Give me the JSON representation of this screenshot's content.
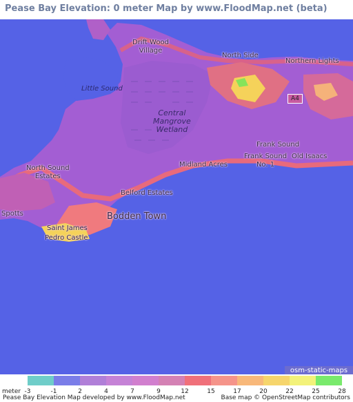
{
  "title": "Pease Bay Elevation: 0 meter Map by www.FloodMap.net (beta)",
  "map": {
    "colors": {
      "sea": "#5562e6",
      "land_low": "#a35ed3",
      "land_mid": "#c560b8",
      "land_high": "#f07a7e",
      "land_peak": "#f5d25a",
      "land_top": "#86e45a"
    },
    "places": [
      {
        "id": "drift-wood-village",
        "text": "Drift Wood\nVillage"
      },
      {
        "id": "north-side",
        "text": "North Side"
      },
      {
        "id": "northern-lights",
        "text": "Northern Lights"
      },
      {
        "id": "little-sound",
        "text": "Little Sound"
      },
      {
        "id": "central-mangrove-wetland",
        "text": "Central\nMangrove\nWetland"
      },
      {
        "id": "frank-sound",
        "text": "Frank Sound"
      },
      {
        "id": "frank-sound-no-1",
        "text": "Frank Sound\nNo. 1"
      },
      {
        "id": "old-isaacs",
        "text": "Old Isaacs"
      },
      {
        "id": "north-sound-estates",
        "text": "North Sound\nEstates"
      },
      {
        "id": "midland-acres",
        "text": "Midland Acres"
      },
      {
        "id": "belford-estates",
        "text": "Belford Estates"
      },
      {
        "id": "bodden-town",
        "text": "Bodden Town"
      },
      {
        "id": "spotts",
        "text": "Spotts"
      },
      {
        "id": "saint-james",
        "text": "Saint James"
      },
      {
        "id": "pedro-castle",
        "text": "Pedro Castle"
      }
    ],
    "road_shield": "A4",
    "attribution_badge": "osm-static-maps"
  },
  "legend": {
    "unit": "meter",
    "items": [
      {
        "label": "-3",
        "color": "#6fcdc9"
      },
      {
        "label": "-1",
        "color": "#7a7de8"
      },
      {
        "label": "2",
        "color": "#b07fd8"
      },
      {
        "label": "4",
        "color": "#c582d6"
      },
      {
        "label": "7",
        "color": "#d17fce"
      },
      {
        "label": "9",
        "color": "#d481b4"
      },
      {
        "label": "12",
        "color": "#f0707a"
      },
      {
        "label": "15",
        "color": "#f5948a"
      },
      {
        "label": "17",
        "color": "#f8b87a"
      },
      {
        "label": "20",
        "color": "#f6d56c"
      },
      {
        "label": "22",
        "color": "#f3f27a"
      },
      {
        "label": "25",
        "color": "#79ea6c"
      },
      {
        "label": "28",
        "color": "#86e45a"
      }
    ],
    "footer_left": "Pease Bay Elevation Map developed by www.FloodMap.net",
    "footer_right": "Base map © OpenStreetMap contributors"
  }
}
